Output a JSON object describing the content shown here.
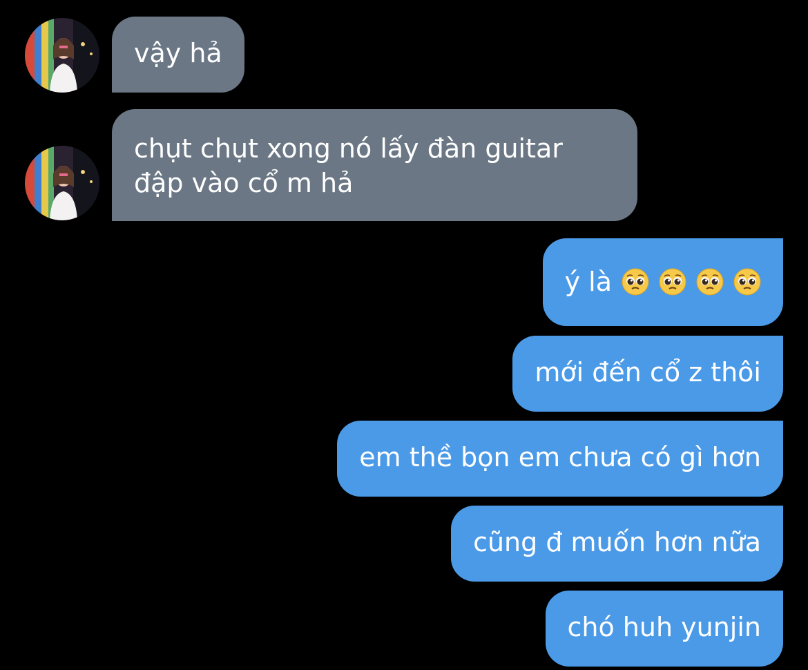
{
  "messages": [
    {
      "direction": "incoming",
      "text": "vậy hả"
    },
    {
      "direction": "incoming",
      "lines": [
        "chụt chụt xong nó lấy đàn guitar",
        "đập vào cổ m hả"
      ]
    },
    {
      "direction": "outgoing",
      "text": "ý là",
      "emoji": [
        "pleading-face",
        "pleading-face",
        "pleading-face",
        "pleading-face"
      ]
    },
    {
      "direction": "outgoing",
      "text": "mới đến cổ z thôi"
    },
    {
      "direction": "outgoing",
      "text": "em thề bọn em chưa có gì hơn"
    },
    {
      "direction": "outgoing",
      "text": "cũng đ muốn hơn nữa"
    },
    {
      "direction": "outgoing",
      "text": "chó huh yunjin"
    }
  ],
  "colors": {
    "background": "#000000",
    "incoming_bubble": "#6b7785",
    "outgoing_bubble": "#4b9ae8",
    "text": "#ffffff"
  }
}
